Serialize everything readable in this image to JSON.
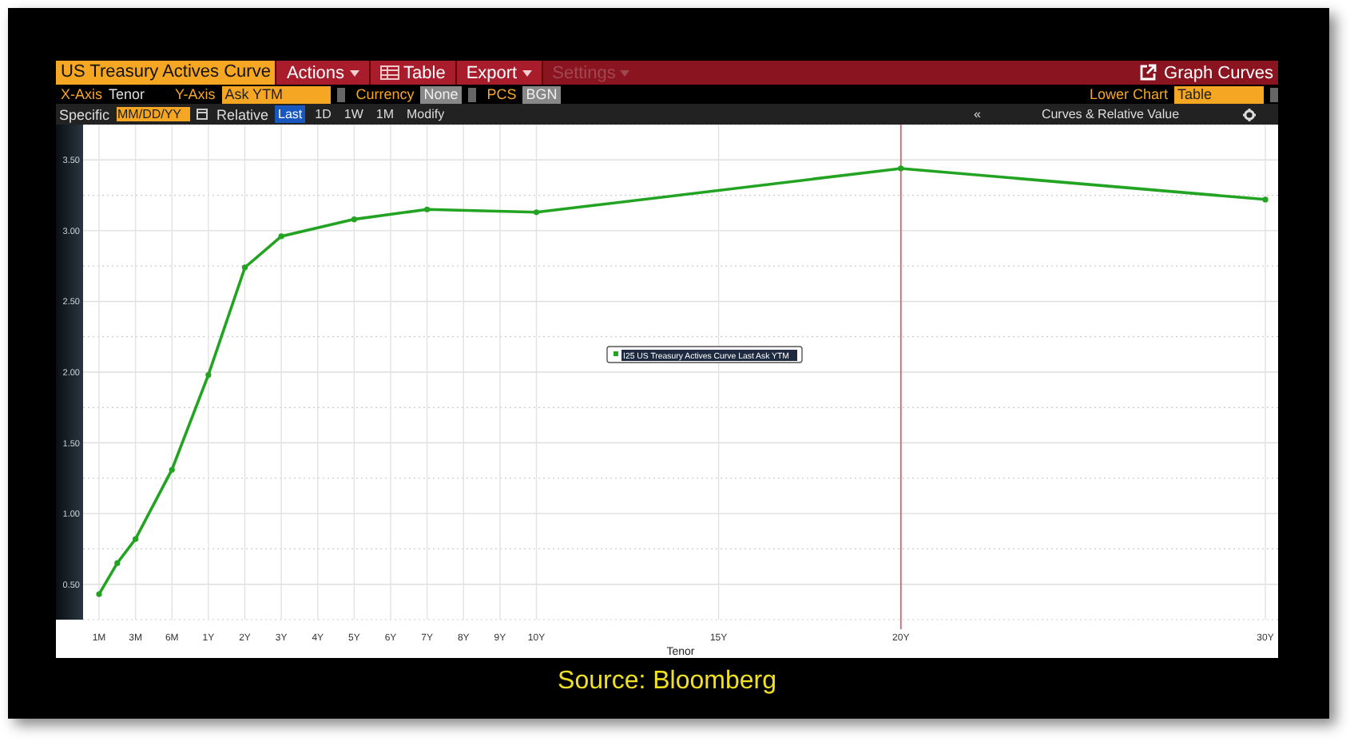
{
  "toolbar": {
    "title": "US Treasury Actives Curve",
    "menus": [
      {
        "label": "Actions",
        "kind": "dropdown",
        "disabled": false
      },
      {
        "label": "Table",
        "kind": "table",
        "disabled": false
      },
      {
        "label": "Export",
        "kind": "dropdown",
        "disabled": false
      },
      {
        "label": "Settings",
        "kind": "dropdown",
        "disabled": true
      }
    ],
    "right_button": "Graph Curves"
  },
  "axis_row": {
    "x_axis_label": "X-Axis",
    "x_axis_value": "Tenor",
    "y_axis_label": "Y-Axis",
    "y_axis_value": "Ask YTM",
    "currency_label": "Currency",
    "currency_value": "None",
    "pcs_label": "PCS",
    "pcs_value": "BGN",
    "lower_chart_label": "Lower Chart",
    "lower_chart_value": "Table"
  },
  "date_row": {
    "specific_label": "Specific",
    "date_placeholder": "MM/DD/YY",
    "relative_label": "Relative",
    "periods": [
      {
        "label": "Last",
        "selected": true
      },
      {
        "label": "1D",
        "selected": false
      },
      {
        "label": "1W",
        "selected": false
      },
      {
        "label": "1M",
        "selected": false
      },
      {
        "label": "Modify",
        "selected": false
      }
    ],
    "collapse": "«",
    "panel_title": "Curves & Relative Value"
  },
  "chart": {
    "chart_data": {
      "type": "line",
      "xlabel": "Tenor",
      "grid": true,
      "categories": [
        "1M",
        null,
        "3M",
        null,
        "6M",
        null,
        "1Y",
        null,
        "2Y",
        null,
        "3Y",
        null,
        "4Y",
        null,
        "5Y",
        null,
        "6Y",
        null,
        "7Y",
        null,
        "8Y",
        null,
        "9Y",
        null,
        "10Y",
        null,
        null,
        null,
        null,
        null,
        null,
        null,
        null,
        null,
        "15Y",
        null,
        null,
        null,
        null,
        null,
        null,
        null,
        null,
        null,
        "20Y",
        null,
        null,
        null,
        null,
        null,
        null,
        null,
        null,
        null,
        null,
        null,
        null,
        null,
        null,
        null,
        null,
        null,
        null,
        null,
        "30Y"
      ],
      "series": [
        {
          "name": "I25 US Treasury Actives Curve Last Ask YTM",
          "color": "#22a322",
          "marker": "circle",
          "values": [
            0.43,
            0.65,
            0.82,
            null,
            1.31,
            null,
            1.98,
            null,
            2.74,
            null,
            2.96,
            null,
            null,
            null,
            3.08,
            null,
            null,
            null,
            3.15,
            null,
            null,
            null,
            null,
            null,
            3.13,
            null,
            null,
            null,
            null,
            null,
            null,
            null,
            null,
            null,
            null,
            null,
            null,
            null,
            null,
            null,
            null,
            null,
            null,
            null,
            3.44,
            null,
            null,
            null,
            null,
            null,
            null,
            null,
            null,
            null,
            null,
            null,
            null,
            null,
            null,
            null,
            null,
            null,
            null,
            null,
            3.22
          ]
        }
      ],
      "ylim": [
        0.25,
        3.75
      ],
      "yticks": [
        {
          "value": 0.5,
          "label": "0.50"
        },
        {
          "value": 1,
          "label": "1.00"
        },
        {
          "value": 1.5,
          "label": "1.50"
        },
        {
          "value": 2,
          "label": "2.00"
        },
        {
          "value": 2.5,
          "label": "2.50"
        },
        {
          "value": 3,
          "label": "3.00"
        },
        {
          "value": 3.5,
          "label": "3.50"
        }
      ]
    }
  },
  "caption": "Source: Bloomberg"
}
